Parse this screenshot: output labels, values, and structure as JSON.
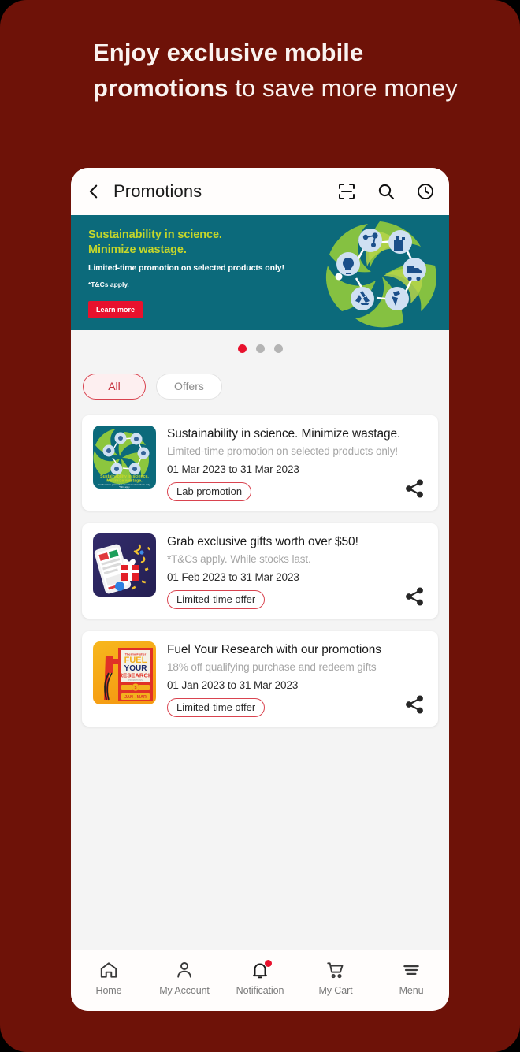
{
  "headline": {
    "bold_1": "Enjoy exclusive mobile",
    "bold_2": "promotions",
    "rest": " to save more money"
  },
  "colors": {
    "page_background": "#6E1208",
    "banner_teal": "#0C6A7B",
    "banner_heading": "#C5D62B",
    "accent_red": "#E8112D",
    "tag_border": "#D9434F",
    "content_background": "#F4F4F4"
  },
  "appbar": {
    "back_icon": "chevron-left-icon",
    "title": "Promotions",
    "actions": [
      {
        "icon": "scan-icon"
      },
      {
        "icon": "search-icon"
      },
      {
        "icon": "history-clock-icon"
      }
    ]
  },
  "banner": {
    "heading_line1": "Sustainability in science.",
    "heading_line2": "Minimize wastage.",
    "subtitle": "Limited-time promotion on selected products only!",
    "terms": "*T&Cs apply.",
    "button_label": "Learn more",
    "artwork": "sustainability-cycle-graphic"
  },
  "carousel": {
    "total_dots": 3,
    "active_index": 0
  },
  "filters": {
    "chips": [
      {
        "label": "All",
        "selected": true
      },
      {
        "label": "Offers",
        "selected": false
      }
    ]
  },
  "promotions": [
    {
      "thumbnail": "sustainability-thumbnail",
      "title": "Sustainability in science. Minimize wastage.",
      "description": "Limited-time promotion on selected products only!",
      "date_range": "01 Mar 2023 to 31 Mar 2023",
      "tag": "Lab promotion",
      "share_icon": "share-icon"
    },
    {
      "thumbnail": "gift-phone-thumbnail",
      "title": "Grab exclusive gifts worth over $50!",
      "description": "*T&Cs apply. While stocks last.",
      "date_range": "01 Feb 2023 to 31 Mar 2023",
      "tag": "Limited-time offer",
      "share_icon": "share-icon"
    },
    {
      "thumbnail": "fuel-your-research-thumbnail",
      "title": "Fuel Your Research with our promotions",
      "description": "18% off qualifying purchase and redeem gifts",
      "date_range": "01 Jan 2023 to 31 Mar 2023",
      "tag": "Limited-time offer",
      "share_icon": "share-icon"
    }
  ],
  "thumbnail_text": {
    "card1_line1": "Sustainability in science.",
    "card1_line2": "Minimize wastage.",
    "card1_line3": "Limited-time promotion on selected products only!",
    "card1_line4": "*T&Cs apply.",
    "card3_brand": "ThermoFisher",
    "card3_line1": "FUEL",
    "card3_line2": "YOUR",
    "card3_line3": "RESEARCH",
    "card3_line4": "PROMOTIONS",
    "card3_banner": "JAN - MAR"
  },
  "bottom_nav": [
    {
      "icon": "home-icon",
      "label": "Home",
      "badge": false
    },
    {
      "icon": "person-icon",
      "label": "My Account",
      "badge": false
    },
    {
      "icon": "bell-icon",
      "label": "Notification",
      "badge": true
    },
    {
      "icon": "cart-icon",
      "label": "My Cart",
      "badge": false
    },
    {
      "icon": "hamburger-menu-icon",
      "label": "Menu",
      "badge": false
    }
  ]
}
